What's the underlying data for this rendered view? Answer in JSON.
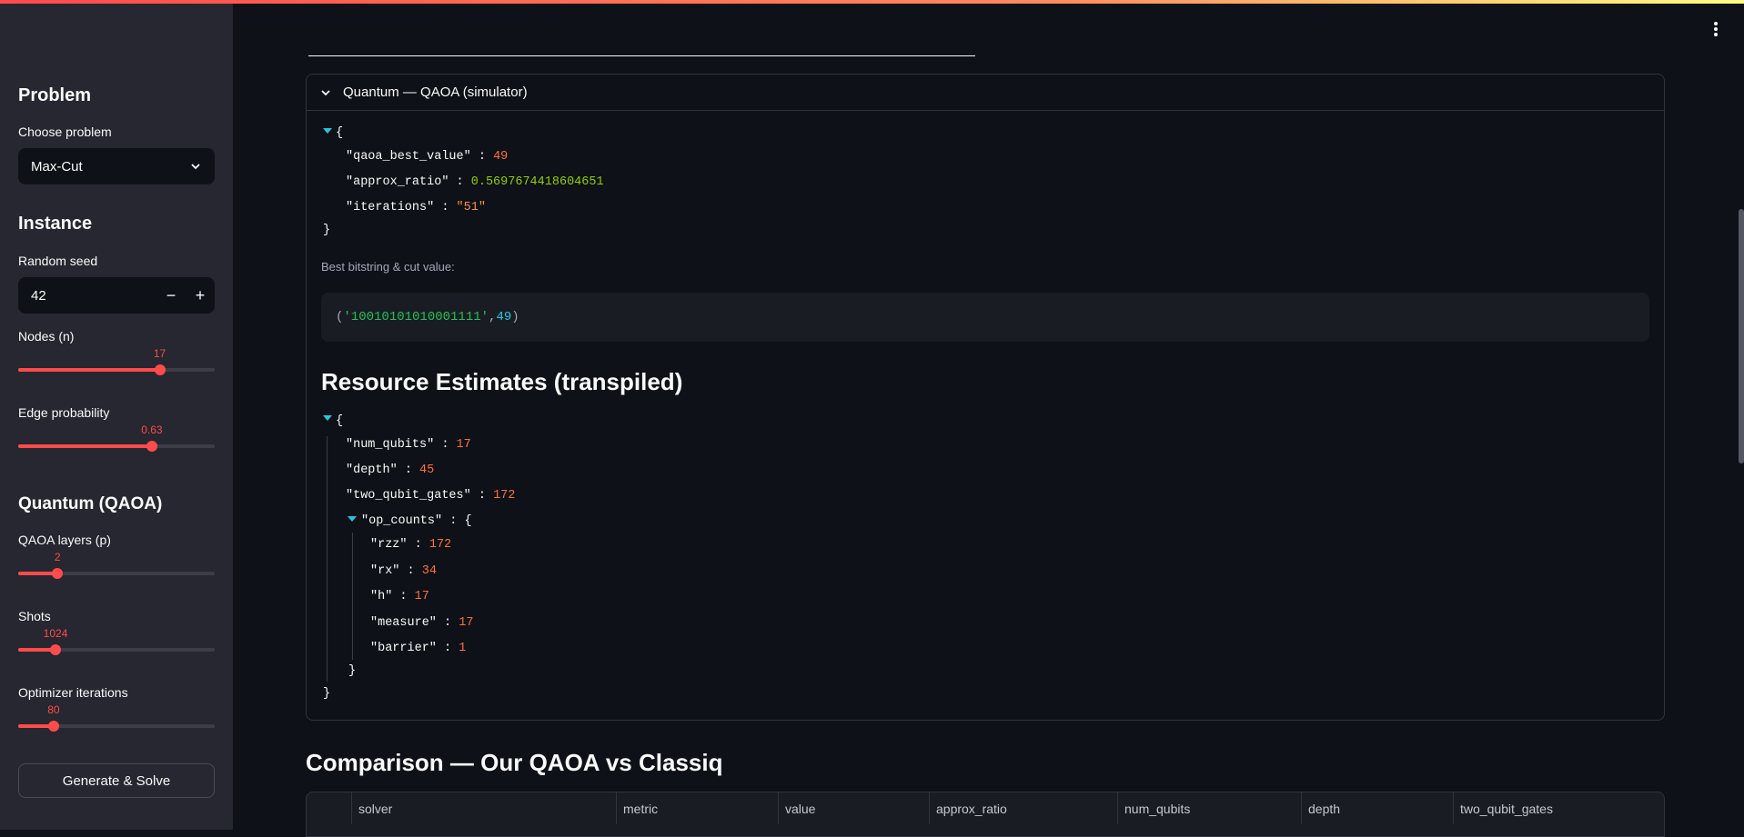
{
  "sidebar": {
    "problem_heading": "Problem",
    "choose_problem_label": "Choose problem",
    "choose_problem_value": "Max-Cut",
    "instance_heading": "Instance",
    "seed_label": "Random seed",
    "seed_value": "42",
    "minus": "−",
    "plus": "+",
    "nodes_label": "Nodes (n)",
    "nodes_value": "17",
    "nodes_fraction": 0.72,
    "edge_prob_label": "Edge probability",
    "edge_prob_value": "0.63",
    "edge_prob_fraction": 0.68,
    "quantum_heading": "Quantum (QAOA)",
    "layers_label": "QAOA layers (p)",
    "layers_value": "2",
    "layers_fraction": 0.2,
    "shots_label": "Shots",
    "shots_value": "1024",
    "shots_fraction": 0.19,
    "iters_label": "Optimizer iterations",
    "iters_value": "80",
    "iters_fraction": 0.18,
    "generate_button": "Generate & Solve"
  },
  "expander": {
    "title": "Quantum — QAOA (simulator)",
    "json1": {
      "open": "{",
      "close": "}",
      "k1": "\"qaoa_best_value\"",
      "v1": "49",
      "k2": "\"approx_ratio\"",
      "v2": "0.5697674418604651",
      "k3": "\"iterations\"",
      "v3": "\"51\""
    },
    "caption": "Best bitstring & cut value:",
    "code": {
      "open": "(",
      "bitstring": "'10010101010001111'",
      "sep": ", ",
      "value": "49",
      "close": ")"
    },
    "resource_heading": "Resource Estimates (transpiled)",
    "json2": {
      "open": "{",
      "close": "}",
      "k1": "\"num_qubits\"",
      "v1": "17",
      "k2": "\"depth\"",
      "v2": "45",
      "k3": "\"two_qubit_gates\"",
      "v3": "172",
      "k4": "\"op_counts\"",
      "v4": "{",
      "rzz_k": "\"rzz\"",
      "rzz_v": "172",
      "rx_k": "\"rx\"",
      "rx_v": "34",
      "h_k": "\"h\"",
      "h_v": "17",
      "measure_k": "\"measure\"",
      "measure_v": "17",
      "barrier_k": "\"barrier\"",
      "barrier_v": "1",
      "inner_close": "}"
    }
  },
  "colon": ":",
  "comparison_heading": "Comparison — Our QAOA vs Classiq",
  "table": {
    "columns": [
      "solver",
      "metric",
      "value",
      "approx_ratio",
      "num_qubits",
      "depth",
      "two_qubit_gates"
    ]
  }
}
